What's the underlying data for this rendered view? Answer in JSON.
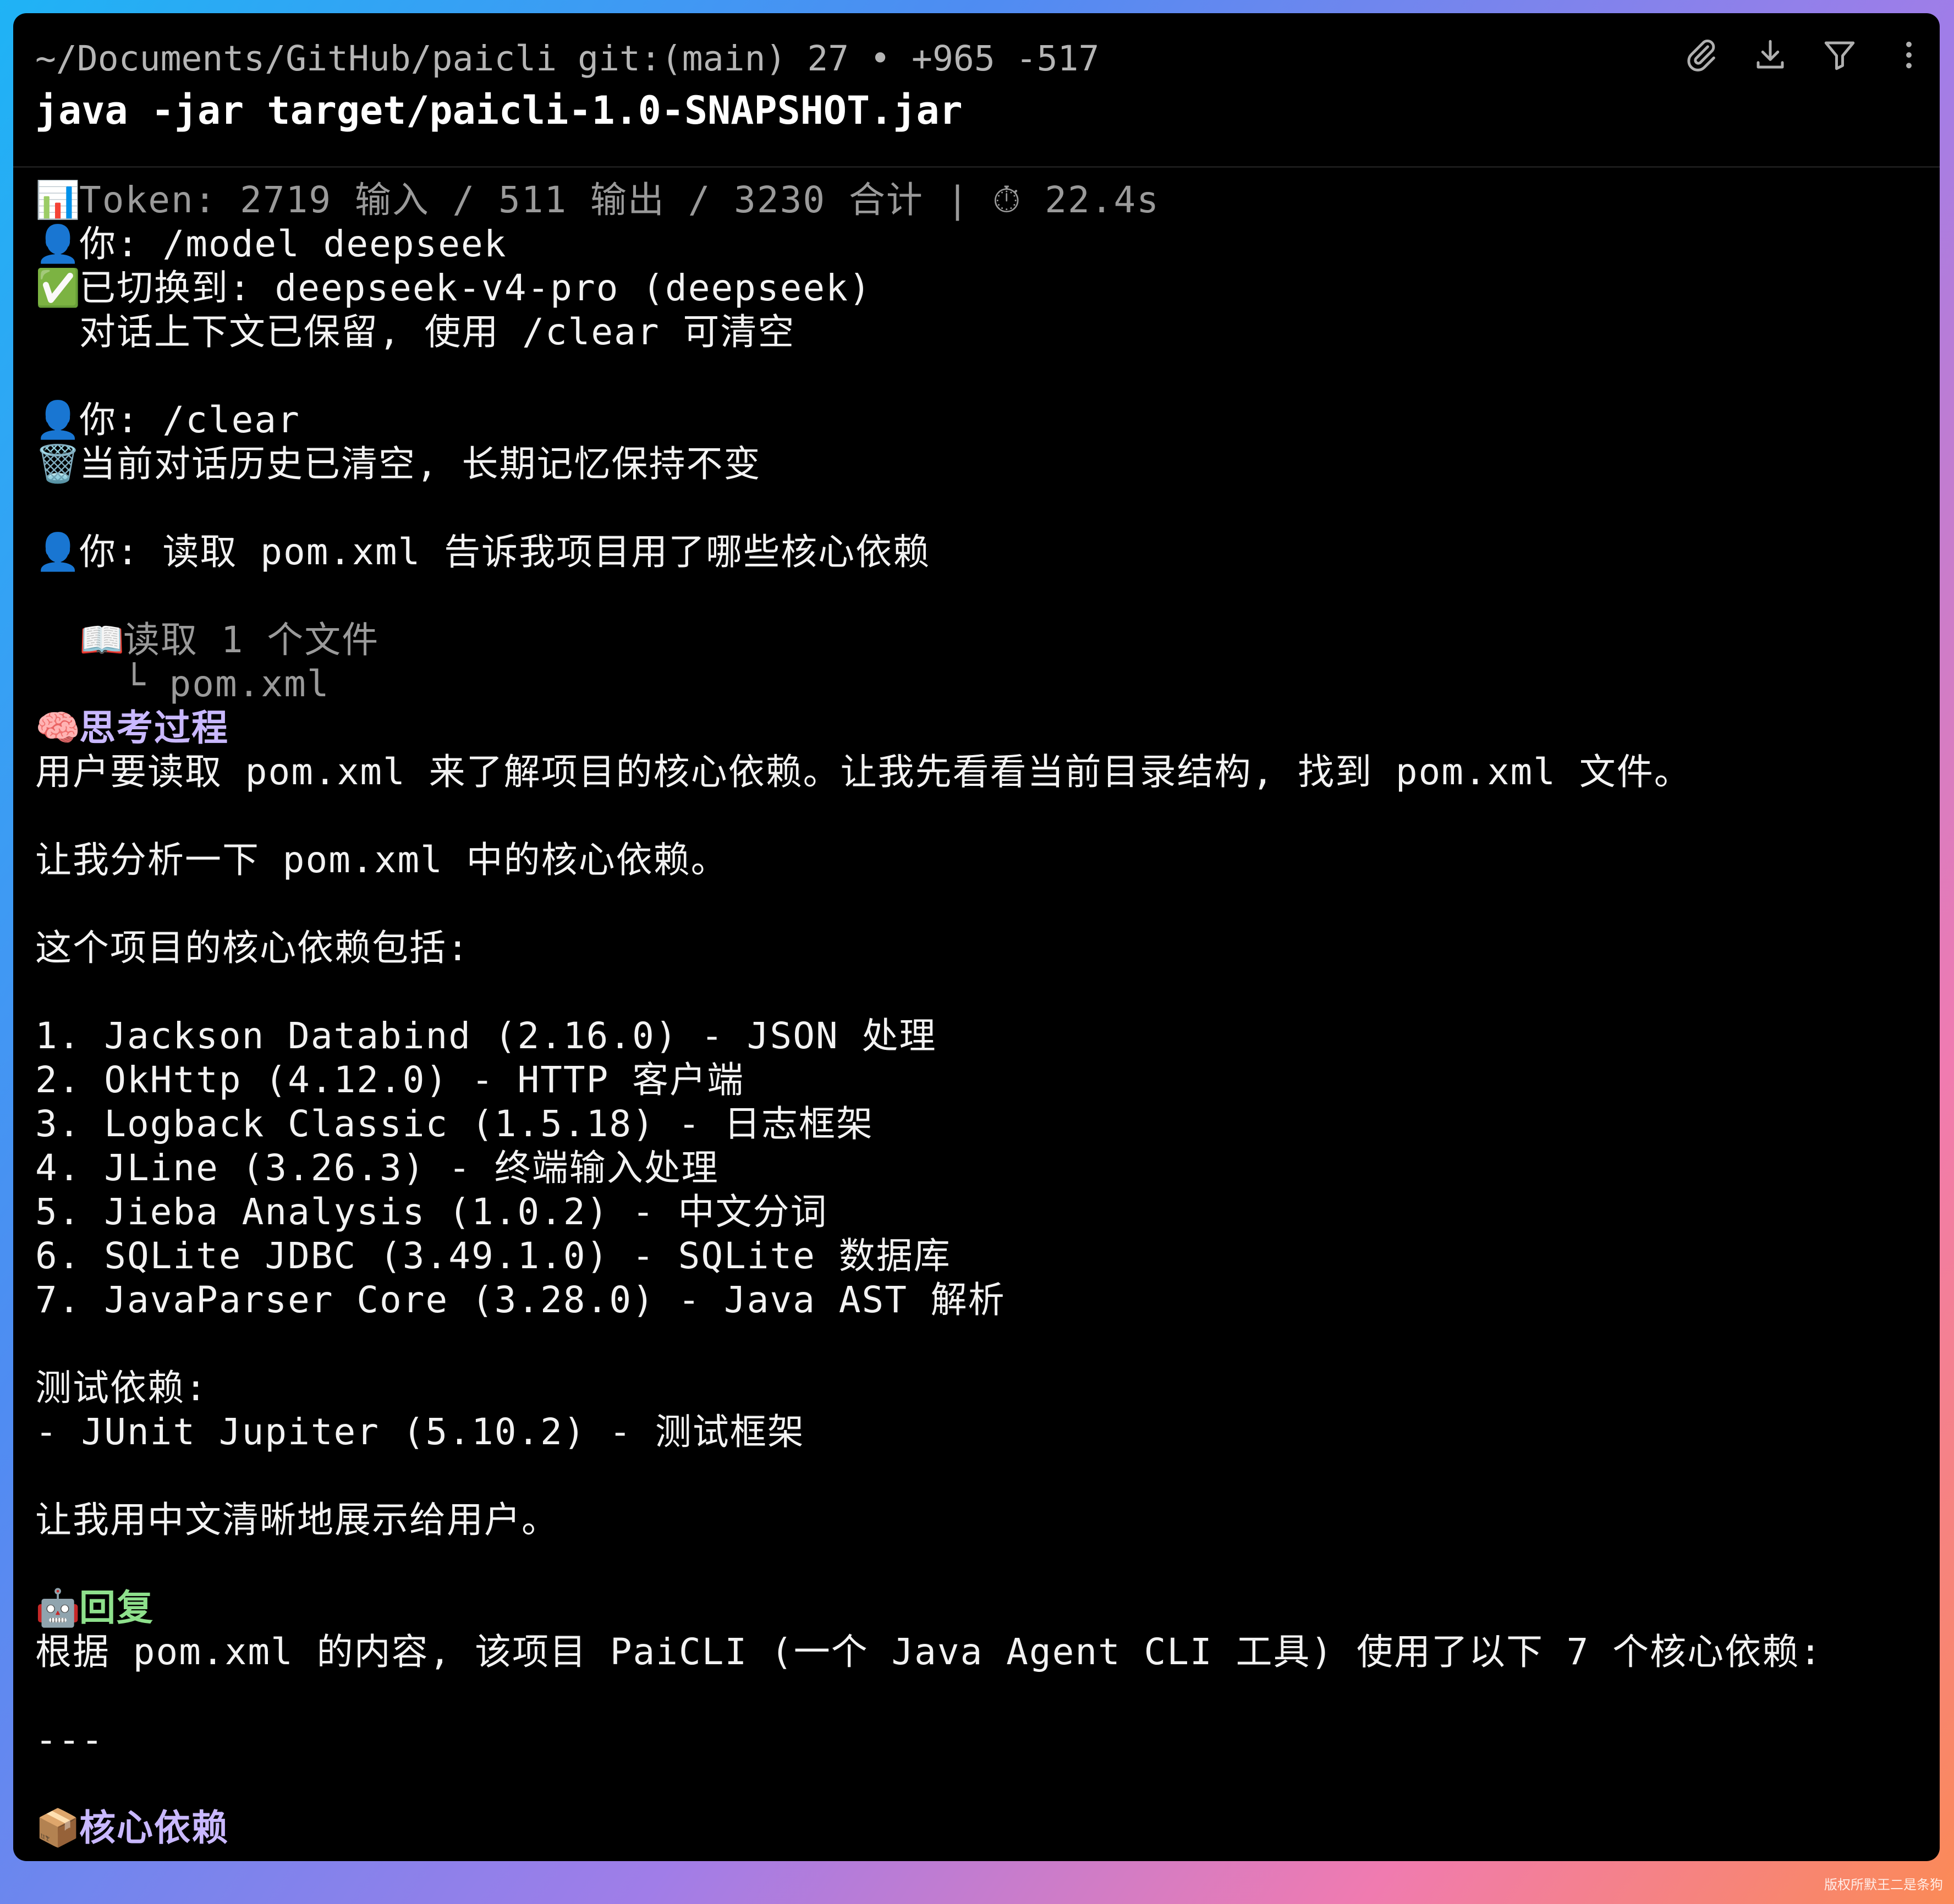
{
  "header": {
    "path": "~/Documents/GitHub/paicli git:(main) 27 • +965 -517",
    "command": "java -jar target/paicli-1.0-SNAPSHOT.jar"
  },
  "toolbar": {
    "icons": [
      "paperclip-icon",
      "download-icon",
      "filter-icon",
      "more-vertical-icon"
    ]
  },
  "session": {
    "token_emoji": "📊",
    "token_line": "Token: 2719 输入 / 511 输出 / 3230 合计 | ⏱ 22.4s",
    "user_emoji": "👤",
    "check_emoji": "✅",
    "trash_emoji": "🗑️",
    "book_emoji": "📖",
    "brain_emoji": "🧠",
    "robot_emoji": "🤖",
    "package_emoji": "📦",
    "user1": "你: /model deepseek",
    "switched": "已切换到: deepseek-v4-pro (deepseek)",
    "context_kept": "对话上下文已保留, 使用 /clear 可清空",
    "user2": "你: /clear",
    "cleared": "当前对话历史已清空, 长期记忆保持不变",
    "user3": "你: 读取 pom.xml 告诉我项目用了哪些核心依赖",
    "read_files": "读取 1 个文件",
    "read_file_item": "└ pom.xml",
    "thinking_title": "思考过程",
    "thinking_p1": "用户要读取 pom.xml 来了解项目的核心依赖。让我先看看当前目录结构, 找到 pom.xml 文件。",
    "thinking_p2": "让我分析一下 pom.xml 中的核心依赖。",
    "thinking_p3": "这个项目的核心依赖包括:",
    "deps": [
      "1. Jackson Databind (2.16.0) - JSON 处理",
      "2. OkHttp (4.12.0) - HTTP 客户端",
      "3. Logback Classic (1.5.18) - 日志框架",
      "4. JLine (3.26.3) - 终端输入处理",
      "5. Jieba Analysis (1.0.2) - 中文分词",
      "6. SQLite JDBC (3.49.1.0) - SQLite 数据库",
      "7. JavaParser Core (3.28.0) - Java AST 解析"
    ],
    "test_deps_title": "测试依赖:",
    "test_dep": "- JUnit Jupiter (5.10.2) - 测试框架",
    "thinking_p4": "让我用中文清晰地展示给用户。",
    "reply_title": "回复",
    "reply_p1": "根据 pom.xml 的内容, 该项目 PaiCLI (一个 Java Agent CLI 工具) 使用了以下 7 个核心依赖:",
    "separator": "---",
    "core_deps_title": "核心依赖"
  },
  "watermark": "版权所默王二是条狗"
}
